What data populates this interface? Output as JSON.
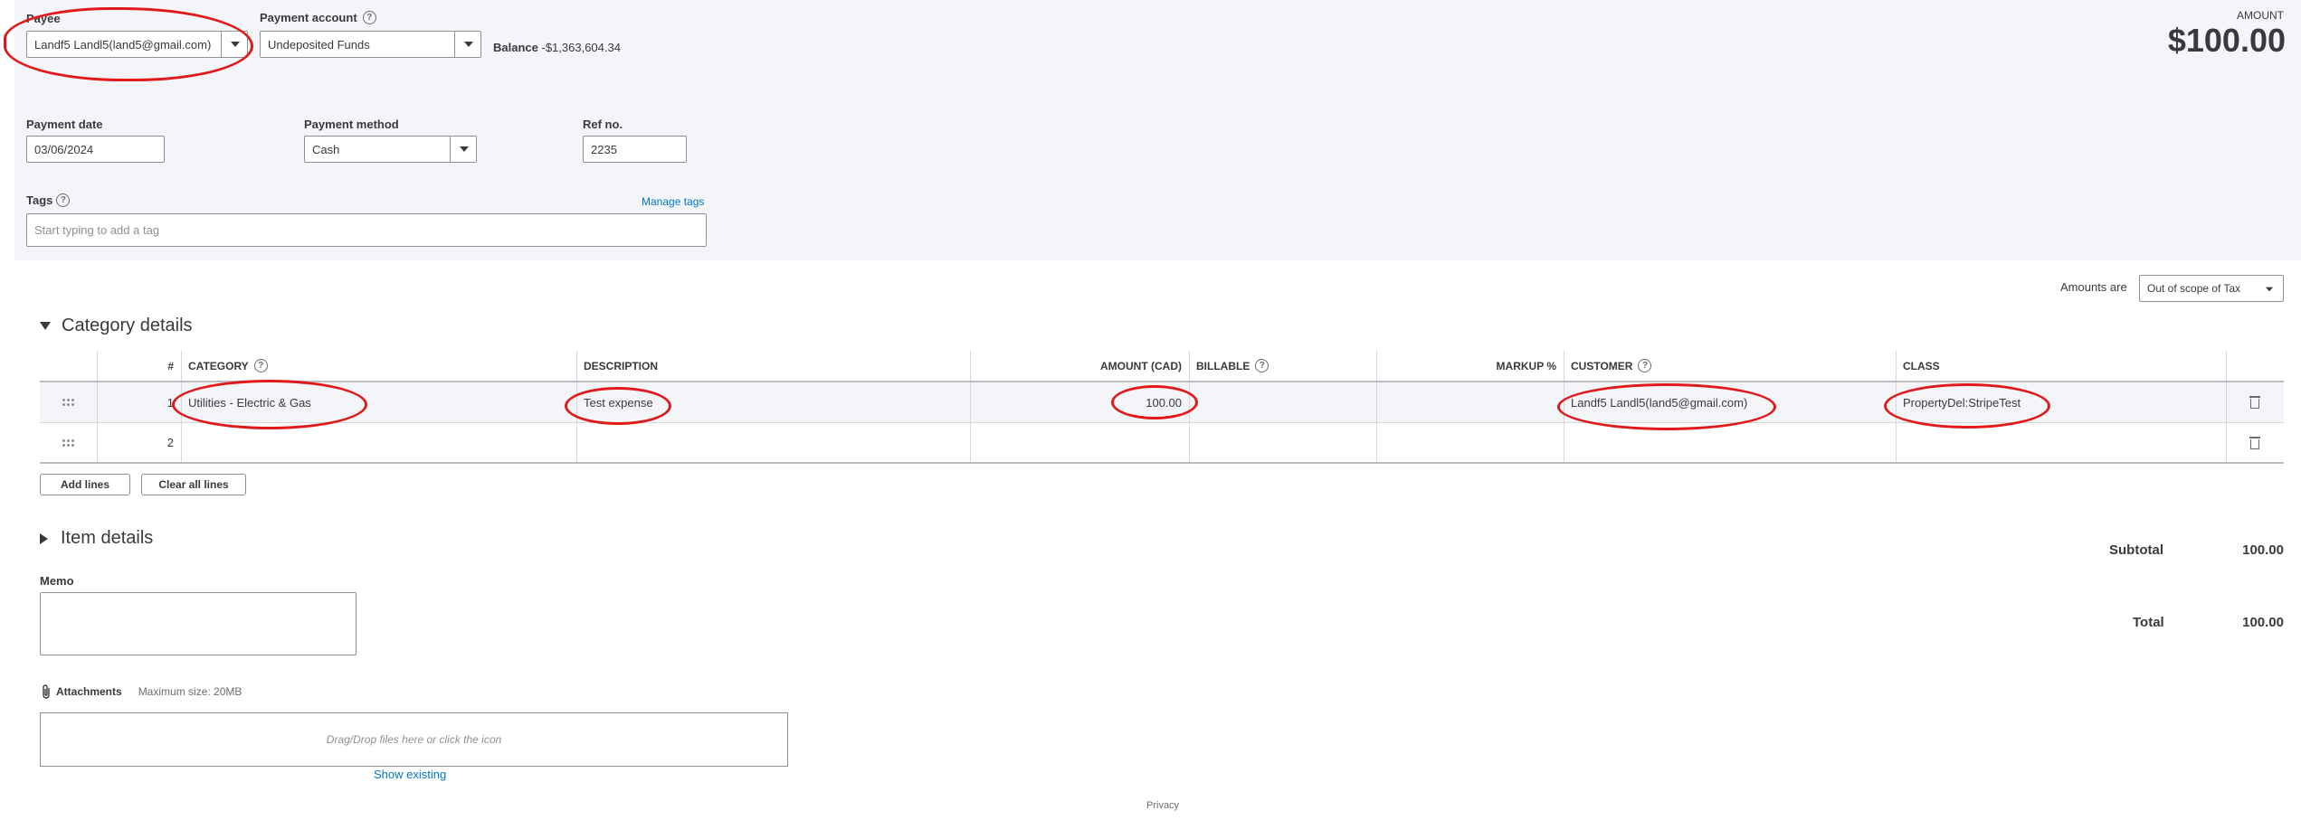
{
  "header": {
    "payee_label": "Payee",
    "payee_value": "Landf5 Landl5(land5@gmail.com)",
    "payment_account_label": "Payment account",
    "payment_account_value": "Undeposited Funds",
    "balance_label": "Balance",
    "balance_value": "-$1,363,604.34",
    "amount_label": "AMOUNT",
    "amount_value": "$100.00",
    "payment_date_label": "Payment date",
    "payment_date_value": "03/06/2024",
    "payment_method_label": "Payment method",
    "payment_method_value": "Cash",
    "ref_no_label": "Ref no.",
    "ref_no_value": "2235",
    "tags_label": "Tags",
    "manage_tags_link": "Manage tags",
    "tags_placeholder": "Start typing to add a tag"
  },
  "amounts_are": {
    "label": "Amounts are",
    "value": "Out of scope of Tax"
  },
  "category_details": {
    "title": "Category details",
    "columns": {
      "num": "#",
      "category": "CATEGORY",
      "description": "DESCRIPTION",
      "amount": "AMOUNT (CAD)",
      "billable": "BILLABLE",
      "markup": "MARKUP %",
      "customer": "CUSTOMER",
      "class": "CLASS"
    },
    "rows": [
      {
        "num": "1",
        "category": "Utilities - Electric & Gas",
        "description": "Test expense",
        "amount": "100.00",
        "billable": "",
        "markup": "",
        "customer": "Landf5 Landl5(land5@gmail.com)",
        "class": "PropertyDel:StripeTest"
      },
      {
        "num": "2",
        "category": "",
        "description": "",
        "amount": "",
        "billable": "",
        "markup": "",
        "customer": "",
        "class": ""
      }
    ],
    "add_lines_label": "Add lines",
    "clear_all_lines_label": "Clear all lines"
  },
  "item_details": {
    "title": "Item details"
  },
  "totals": {
    "subtotal_label": "Subtotal",
    "subtotal_value": "100.00",
    "total_label": "Total",
    "total_value": "100.00"
  },
  "memo": {
    "label": "Memo"
  },
  "attachments": {
    "label": "Attachments",
    "max_size": "Maximum size: 20MB",
    "drop_text": "Drag/Drop files here or click the icon",
    "show_existing": "Show existing"
  },
  "footer": {
    "privacy": "Privacy"
  },
  "icons": {
    "dropdown": "chevron-down-icon",
    "help": "help-circle-icon",
    "drag": "drag-handle-icon",
    "delete": "trash-icon",
    "attachment": "paperclip-icon"
  },
  "colors": {
    "link": "#0077c5",
    "annotation": "#e01a1a",
    "panel_bg": "#f4f5f8"
  }
}
